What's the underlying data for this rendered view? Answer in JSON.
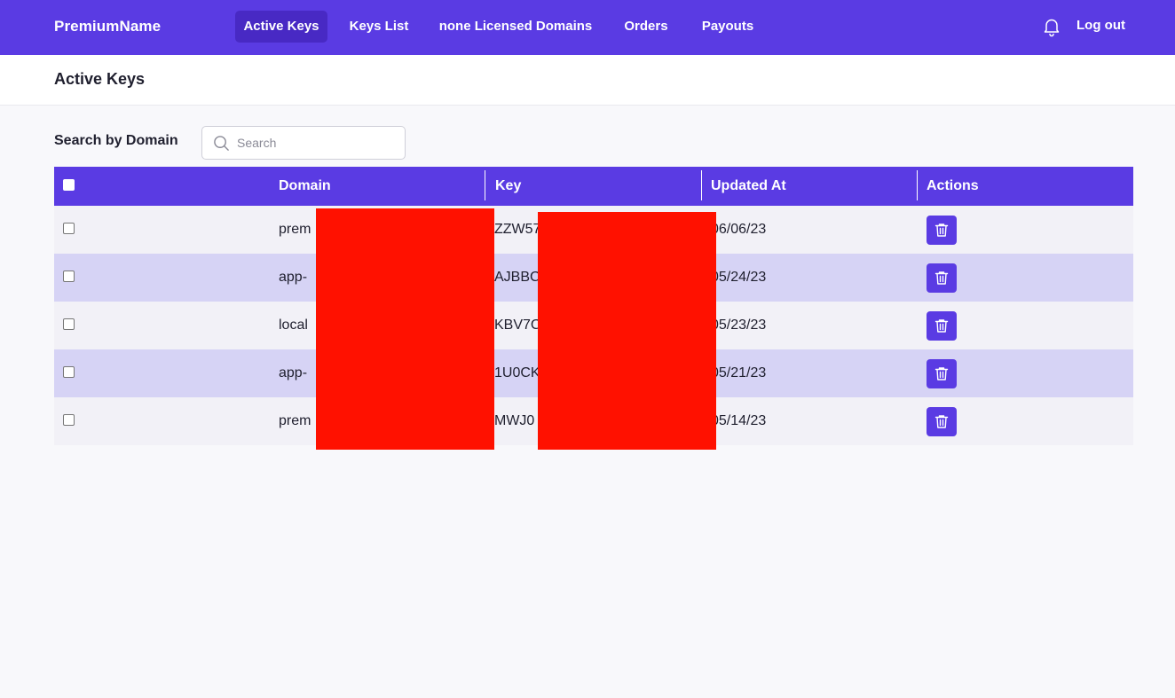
{
  "app": {
    "brand": "PremiumName"
  },
  "nav": {
    "items": [
      {
        "label": "Active Keys",
        "active": true
      },
      {
        "label": "Keys List",
        "active": false
      },
      {
        "label": "none Licensed Domains",
        "active": false
      },
      {
        "label": "Orders",
        "active": false
      },
      {
        "label": "Payouts",
        "active": false
      }
    ],
    "notification_icon": "bell-icon",
    "logout_label": "Log out"
  },
  "page": {
    "title": "Active Keys"
  },
  "search": {
    "label": "Search by Domain",
    "placeholder": "Search",
    "value": ""
  },
  "table": {
    "columns": [
      "Domain",
      "Key",
      "Updated At",
      "Actions"
    ],
    "rows": [
      {
        "domain": "prem",
        "key": "ZZW57",
        "updated_at": "06/06/23",
        "checked": false
      },
      {
        "domain": "app-",
        "key": "AJBBC",
        "updated_at": "05/24/23",
        "checked": false
      },
      {
        "domain": "local",
        "key": "KBV7C",
        "updated_at": "05/23/23",
        "checked": false
      },
      {
        "domain": "app-",
        "key": "1U0CK",
        "updated_at": "05/21/23",
        "checked": false
      },
      {
        "domain": "prem",
        "key": "MWJ0",
        "updated_at": "05/14/23",
        "checked": false
      }
    ],
    "action_icon": "trash-icon"
  },
  "colors": {
    "primary": "#5a3be3",
    "nav_active": "#4829c4",
    "row_odd": "#f2f1f7",
    "row_even": "#d6d3f5",
    "redaction": "#ff1100"
  }
}
